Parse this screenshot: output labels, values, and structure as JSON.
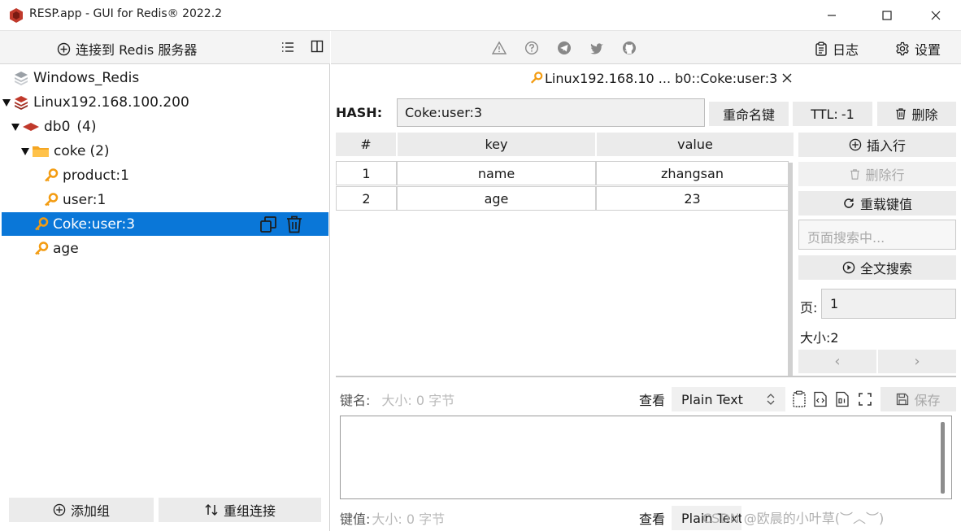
{
  "window": {
    "title": "RESP.app - GUI for Redis® 2022.2"
  },
  "left": {
    "connect_label": "连接到 Redis 服务器",
    "tree": {
      "windows_conn": "Windows_Redis",
      "linux_conn": "Linux192.168.100.200",
      "db_name": "db0",
      "db_count": "(4)",
      "folder_name": "coke",
      "folder_count": "(2)",
      "key_product": "product:1",
      "key_user": "user:1",
      "key_selected": "Coke:user:3",
      "key_age": "age"
    },
    "add_group_label": "添加组",
    "reconnect_label": "重组连接"
  },
  "header": {
    "log_label": "日志",
    "settings_label": "设置"
  },
  "tab": {
    "label": "Linux192.168.10 ... b0::Coke:user:3"
  },
  "key": {
    "type_label": "HASH:",
    "name": "Coke:user:3",
    "rename_label": "重命名键",
    "ttl_label": "TTL:",
    "ttl_value": "-1",
    "delete_label": "删除"
  },
  "table": {
    "columns": [
      "#",
      "key",
      "value"
    ],
    "rows": [
      {
        "index": "1",
        "key": "name",
        "value": "zhangsan"
      },
      {
        "index": "2",
        "key": "age",
        "value": "23"
      }
    ]
  },
  "side": {
    "insert_label": "插入行",
    "delete_row_label": "删除行",
    "reload_label": "重载键值",
    "search_placeholder": "页面搜索中...",
    "fulltext_label": "全文搜索",
    "page_label": "页:",
    "page_value": "1",
    "size_label": "大小:",
    "size_value": "2",
    "prev": "‹",
    "next": "›"
  },
  "editor": {
    "key_name_label": "键名:",
    "size_hint": "大小: 0 字节",
    "view_label": "查看",
    "view_value": "Plain Text",
    "save_label": "保存",
    "value_label": "键值:",
    "value_size_hint": "大小: 0 字节",
    "view_label_2": "查看",
    "view_value_2": "Plain Text"
  },
  "watermark": "CSDN @欧晨的小叶草(︶︿︶)"
}
